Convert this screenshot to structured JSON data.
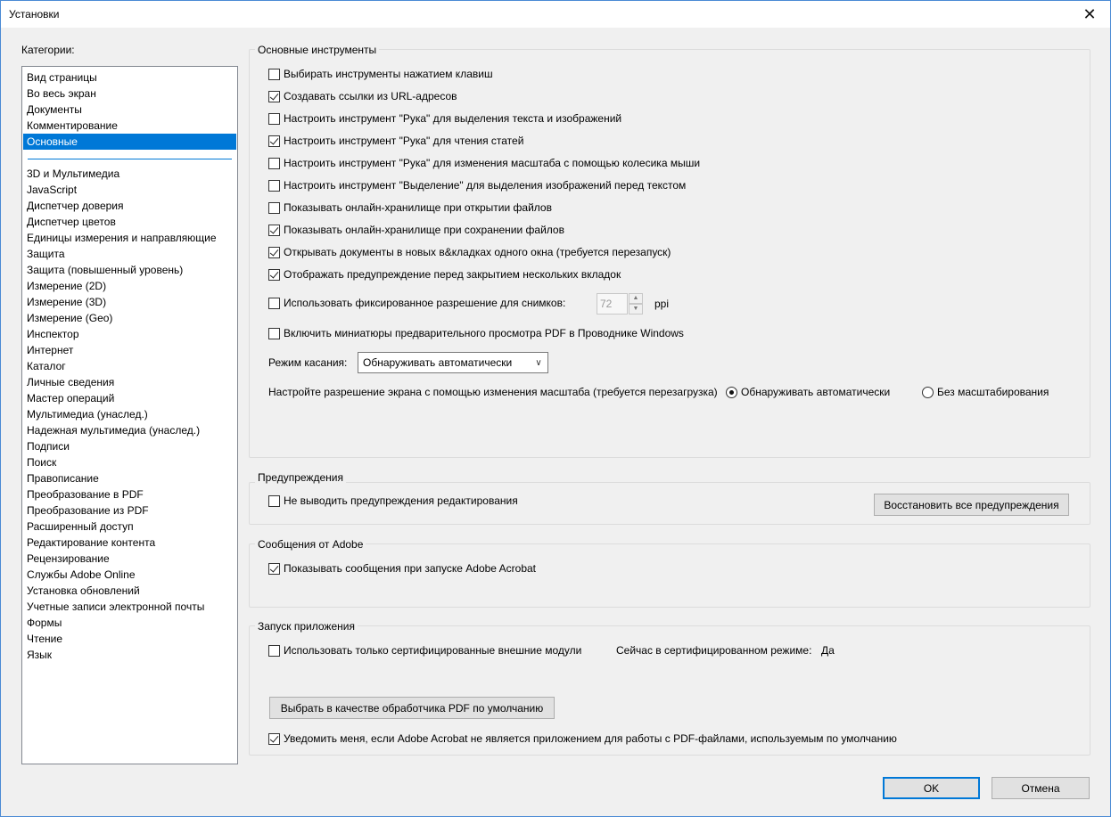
{
  "window": {
    "title": "Установки"
  },
  "categories": {
    "label": "Категории:",
    "top_items": [
      "Вид страницы",
      "Во весь экран",
      "Документы",
      "Комментирование",
      "Основные"
    ],
    "items": [
      "3D и Мультимедиа",
      "JavaScript",
      "Диспетчер доверия",
      "Диспетчер цветов",
      "Единицы измерения и направляющие",
      "Защита",
      "Защита (повышенный уровень)",
      "Измерение (2D)",
      "Измерение (3D)",
      "Измерение (Geo)",
      "Инспектор",
      "Интернет",
      "Каталог",
      "Личные сведения",
      "Мастер операций",
      "Мультимедиа (унаслед.)",
      "Надежная мультимедиа (унаслед.)",
      "Подписи",
      "Поиск",
      "Правописание",
      "Преобразование в PDF",
      "Преобразование из PDF",
      "Расширенный доступ",
      "Редактирование контента",
      "Рецензирование",
      "Службы Adobe Online",
      "Установка обновлений",
      "Учетные записи электронной почты",
      "Формы",
      "Чтение",
      "Язык"
    ],
    "selected": "Основные"
  },
  "basic_tools": {
    "title": "Основные инструменты",
    "options": [
      {
        "label": "Выбирать инструменты нажатием клавиш",
        "checked": false
      },
      {
        "label": "Создавать ссылки из URL-адресов",
        "checked": true
      },
      {
        "label": "Настроить инструмент \"Рука\" для выделения текста и изображений",
        "checked": false
      },
      {
        "label": "Настроить инструмент \"Рука\" для чтения статей",
        "checked": true
      },
      {
        "label": "Настроить инструмент \"Рука\" для изменения масштаба с помощью колесика мыши",
        "checked": false
      },
      {
        "label": "Настроить инструмент \"Выделение\" для выделения изображений перед текстом",
        "checked": false
      },
      {
        "label": "Показывать онлайн-хранилище при открытии файлов",
        "checked": false
      },
      {
        "label": "Показывать онлайн-хранилище при сохранении файлов",
        "checked": true
      },
      {
        "label": "Открывать документы в новых в&кладках одного окна (требуется перезапуск)",
        "checked": true
      },
      {
        "label": "Отображать предупреждение перед закрытием нескольких вкладок",
        "checked": true
      }
    ],
    "fixed_resolution": {
      "label": "Использовать фиксированное разрешение для снимков:",
      "checked": false,
      "value": "72",
      "unit": "ppi"
    },
    "thumbnails": {
      "label": "Включить миниатюры предварительного просмотра PDF в Проводнике Windows",
      "checked": false
    },
    "touch_mode": {
      "label": "Режим касания:",
      "value": "Обнаруживать автоматически"
    },
    "scaling": {
      "label": "Настройте разрешение экрана с помощью изменения масштаба (требуется перезагрузка)",
      "options": [
        {
          "label": "Обнаруживать автоматически",
          "selected": true
        },
        {
          "label": "Без масштабирования",
          "selected": false
        }
      ]
    }
  },
  "warnings": {
    "title": "Предупреждения",
    "option": {
      "label": "Не выводить предупреждения редактирования",
      "checked": false
    },
    "reset_button": "Восстановить все предупреждения"
  },
  "adobe_messages": {
    "title": "Сообщения от Adobe",
    "option": {
      "label": "Показывать сообщения при запуске Adobe Acrobat",
      "checked": true
    }
  },
  "startup": {
    "title": "Запуск приложения",
    "certified_only": {
      "label": "Использовать только сертифицированные внешние модули",
      "checked": false
    },
    "certified_status_label": "Сейчас в сертифицированном режиме:",
    "certified_status_value": "Да",
    "default_handler_button": "Выбрать в качестве обработчика PDF по умолчанию",
    "notify": {
      "label": "Уведомить меня, если Adobe Acrobat не является приложением для работы с PDF-файлами, используемым по умолчанию",
      "checked": true
    }
  },
  "footer": {
    "ok": "OK",
    "cancel": "Отмена"
  }
}
